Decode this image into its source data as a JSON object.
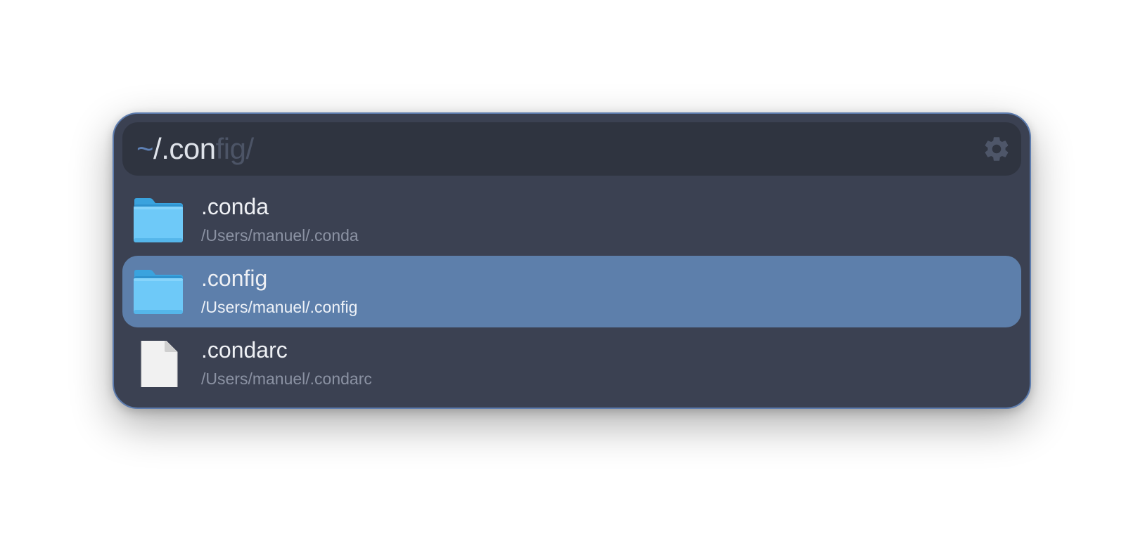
{
  "search": {
    "prefix": "~",
    "typed": "/.con",
    "suggestion": "fig/",
    "settings_icon": "gear-icon"
  },
  "colors": {
    "panel": "#3b4152",
    "search_bg": "#2f3440",
    "selected_row": "#5d7fab",
    "border": "#5d7cae",
    "folder_blue": "#6ec9f8"
  },
  "results": [
    {
      "name": ".conda",
      "path": "/Users/manuel/.conda",
      "icon": "folder-icon",
      "selected": false
    },
    {
      "name": ".config",
      "path": "/Users/manuel/.config",
      "icon": "folder-icon",
      "selected": true
    },
    {
      "name": ".condarc",
      "path": "/Users/manuel/.condarc",
      "icon": "file-icon",
      "selected": false
    }
  ]
}
